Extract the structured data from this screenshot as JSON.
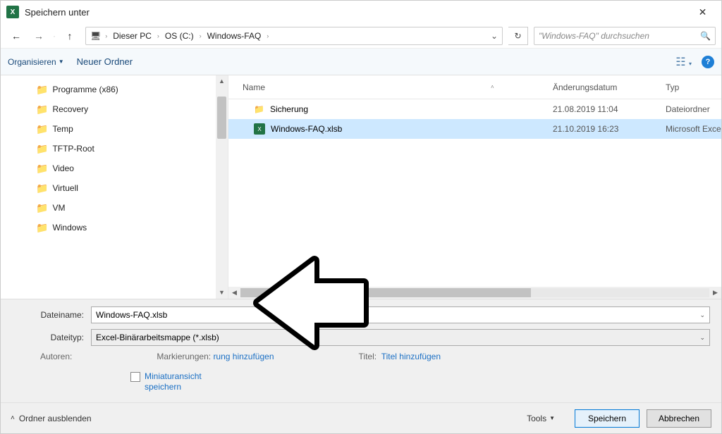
{
  "titlebar": {
    "title": "Speichern unter"
  },
  "nav": {
    "crumbs": [
      "Dieser PC",
      "OS (C:)",
      "Windows-FAQ"
    ],
    "search_placeholder": "\"Windows-FAQ\" durchsuchen"
  },
  "toolbar": {
    "organize": "Organisieren",
    "new_folder": "Neuer Ordner"
  },
  "sidebar": {
    "items": [
      "Programme (x86)",
      "Recovery",
      "Temp",
      "TFTP-Root",
      "Video",
      "Virtuell",
      "VM",
      "Windows"
    ]
  },
  "columns": {
    "name": "Name",
    "date": "Änderungsdatum",
    "type": "Typ"
  },
  "files": [
    {
      "name": "Sicherung",
      "date": "21.08.2019 11:04",
      "type": "Dateiordner",
      "kind": "folder",
      "selected": false
    },
    {
      "name": "Windows-FAQ.xlsb",
      "date": "21.10.2019 16:23",
      "type": "Microsoft Excel-Bin",
      "kind": "xls",
      "selected": true
    }
  ],
  "form": {
    "filename_label": "Dateiname:",
    "filename_value": "Windows-FAQ.xlsb",
    "filetype_label": "Dateityp:",
    "filetype_value": "Excel-Binärarbeitsmappe (*.xlsb)",
    "authors_label": "Autoren:",
    "tags_label": "Markierungen:",
    "tags_link": "rung hinzufügen",
    "title_label": "Titel:",
    "title_link": "Titel hinzufügen",
    "thumbnail_label": "Miniaturansicht\nspeichern"
  },
  "bottom": {
    "hide_folders": "Ordner ausblenden",
    "tools": "Tools",
    "save": "Speichern",
    "cancel": "Abbrechen"
  }
}
